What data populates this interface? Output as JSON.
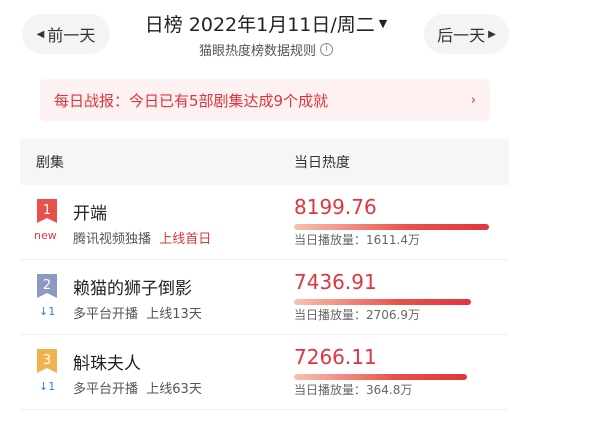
{
  "nav": {
    "prev_label": "前一天",
    "next_label": "后一天",
    "prev_icon": "triangle-left-icon",
    "next_icon": "triangle-right-icon"
  },
  "header": {
    "title": "日榜 2022年1月11日/周二",
    "rules_link": "猫眼热度榜数据规则"
  },
  "banner": {
    "text": "每日战报：今日已有5部剧集达成9个成就"
  },
  "table": {
    "col_show": "剧集",
    "col_heat": "当日热度",
    "rows": [
      {
        "rank": "1",
        "rank_color": "#e8504c",
        "trend": "new",
        "name": "开端",
        "platform": "腾讯视频独播",
        "status": "上线首日",
        "status_highlight": true,
        "heat": "8199.76",
        "heat_fraction": 1.0,
        "plays": "当日播放量：1611.4万"
      },
      {
        "rank": "2",
        "rank_color": "#8d99c4",
        "trend": "↓1",
        "name": "赖猫的狮子倒影",
        "platform": "多平台开播",
        "status": "上线13天",
        "status_highlight": false,
        "heat": "7436.91",
        "heat_fraction": 0.907,
        "plays": "当日播放量：2706.9万"
      },
      {
        "rank": "3",
        "rank_color": "#f0b24e",
        "trend": "↓1",
        "name": "斛珠夫人",
        "platform": "多平台开播",
        "status": "上线63天",
        "status_highlight": false,
        "heat": "7266.11",
        "heat_fraction": 0.886,
        "plays": "当日播放量：364.8万"
      }
    ]
  }
}
